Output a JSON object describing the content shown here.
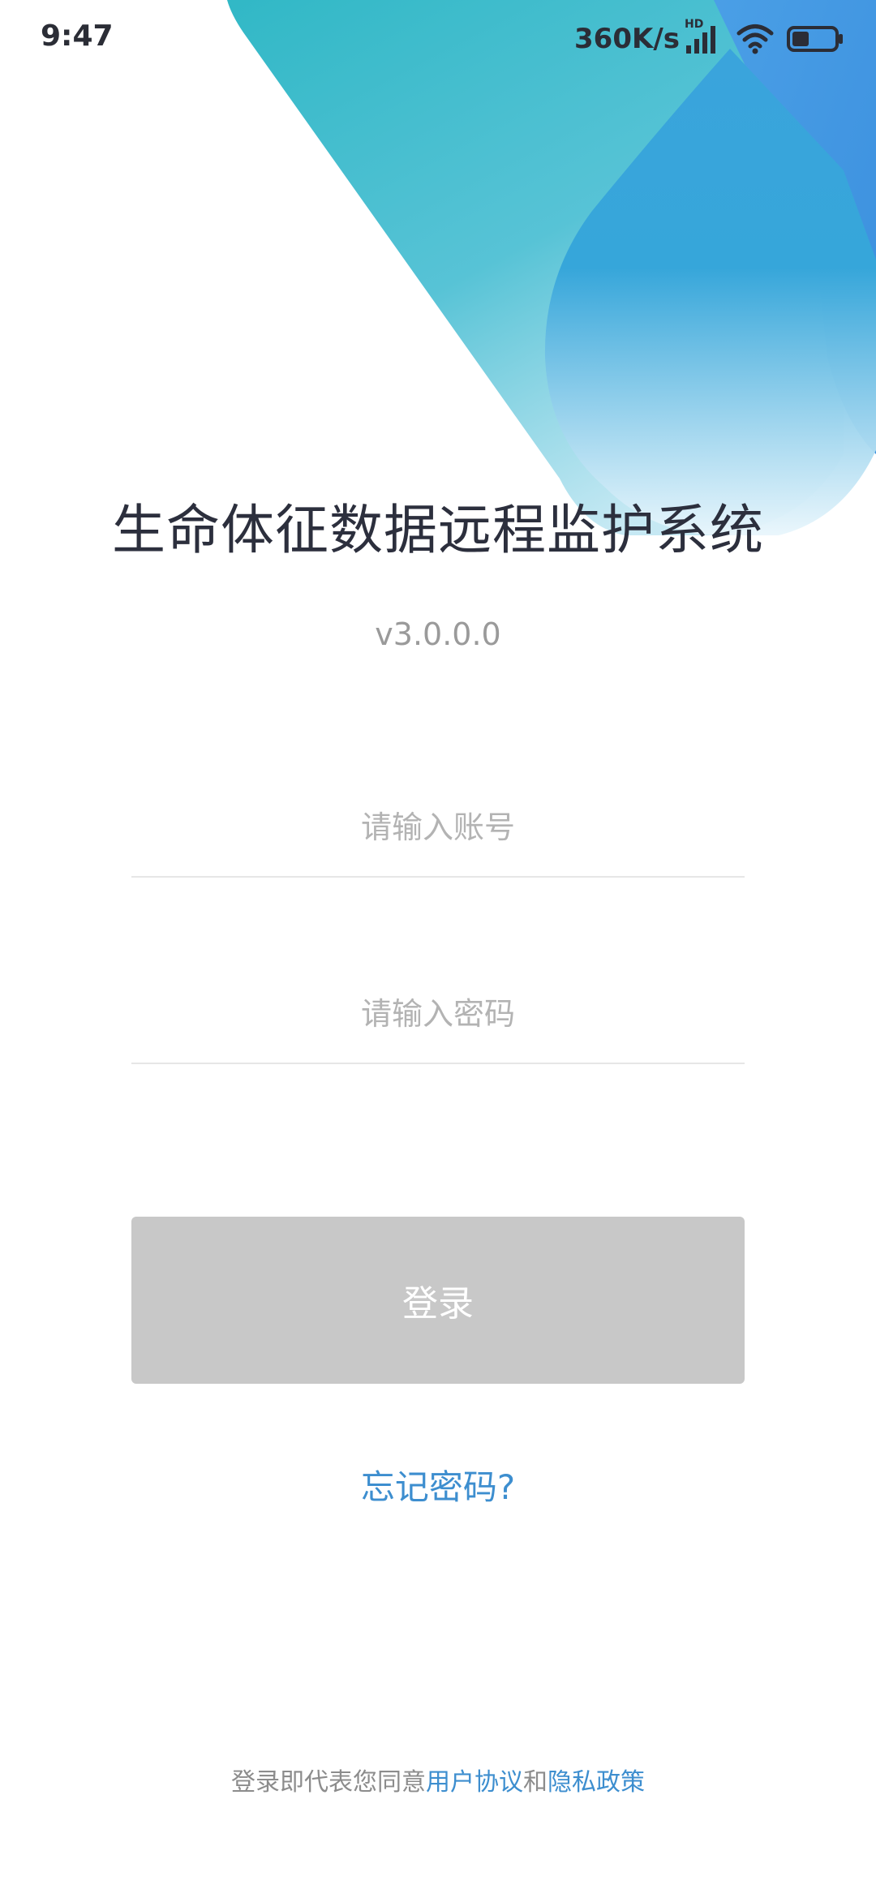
{
  "status_bar": {
    "time": "9:47",
    "net_speed": "360K/s",
    "hd_label": "HD",
    "battery_level": 0.4,
    "icons": [
      "signal-icon",
      "wifi-icon",
      "battery-icon"
    ]
  },
  "app": {
    "title": "生命体征数据远程监护系统",
    "version": "v3.0.0.0"
  },
  "form": {
    "account_placeholder": "请输入账号",
    "account_value": "",
    "password_placeholder": "请输入密码",
    "password_value": "",
    "login_label": "登录",
    "login_enabled": false
  },
  "links": {
    "forgot_password": "忘记密码?"
  },
  "agreement": {
    "prefix": "登录即代表您同意",
    "user_agreement": "用户协议",
    "conjunction": "和",
    "privacy_policy": "隐私政策"
  },
  "colors": {
    "accent": "#3d8ecf",
    "title": "#2c2f3d",
    "button_disabled": "#c8c8c8",
    "teal": "#35bcc6",
    "blue": "#3e98e0"
  }
}
